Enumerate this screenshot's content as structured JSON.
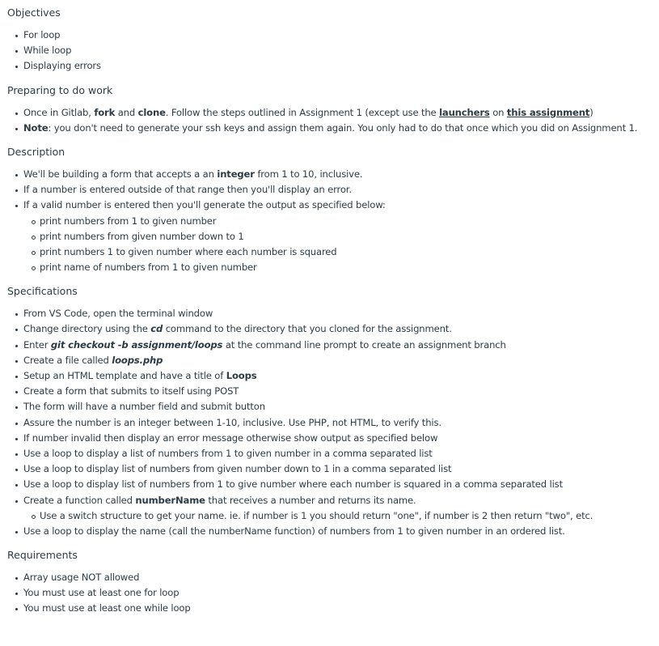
{
  "objectives": {
    "heading": "Objectives",
    "items": [
      "For loop",
      "While loop",
      "Displaying errors"
    ]
  },
  "preparing": {
    "heading": "Preparing to do work",
    "item1": {
      "t1": "Once in Gitlab, ",
      "b1": "fork",
      "t2": " and ",
      "b2": "clone",
      "t3": ". Follow the steps outlined in Assignment 1 (except use the ",
      "link1": "launchers",
      "t4": " on ",
      "link2": "this assignment",
      "t5": ")"
    },
    "item2": {
      "b1": "Note",
      "t1": ": you don't need to generate your ssh keys and assign them again. You only had to do that once which you did on Assignment 1."
    }
  },
  "description": {
    "heading": "Description",
    "item1": {
      "t1": "We'll be building a form that accepts a an ",
      "b1": "integer",
      "t2": " from 1 to 10, inclusive."
    },
    "item2": "If a number is entered outside of that range then you'll display an error.",
    "item3": "If a valid number is entered then you'll generate the output as specified below:",
    "sub_items": [
      "print numbers from 1 to given number",
      "print numbers from given number down to 1",
      "print numbers 1 to given number where each number is squared",
      "print name of numbers from 1 to given number"
    ]
  },
  "specifications": {
    "heading": "Specifications",
    "item1": "From VS Code, open the terminal window",
    "item2": {
      "t1": "Change directory using the ",
      "bi1": "cd",
      "t2": " command to the directory that you cloned for the assignment."
    },
    "item3": {
      "t1": "Enter ",
      "bi1": "git checkout -b assignment/loops",
      "t2": " at the command line prompt to create an assignment branch"
    },
    "item4": {
      "t1": "Create a file called ",
      "bi1": "loops.php"
    },
    "item5": {
      "t1": "Setup an HTML template and have a title of ",
      "b1": "Loops"
    },
    "item6": "Create a form that submits to itself using POST",
    "item7": "The form will have a number field and submit button",
    "item8": "Assure the number is an integer between 1-10, inclusive. Use PHP, not HTML, to verify this.",
    "item9": "If number invalid then display an error message otherwise show output as specified below",
    "item10": "Use a loop to display a list of numbers from 1 to given number in a comma separated list",
    "item11": "Use a loop to display list of numbers from given number down to 1 in a comma separated list",
    "item12": "Use a loop to display list of numbers from 1 to give number where each number is squared in a comma separated list",
    "item13": {
      "t1": "Create a function called ",
      "b1": "numberName",
      "t2": " that receives a number and returns its name."
    },
    "item13_sub": "Use a switch structure to get your name. ie. if number is 1 you should return \"one\", if number is 2 then return \"two\", etc.",
    "item14": "Use a loop to display the name (call the numberName function) of numbers from 1 to given number in an ordered list."
  },
  "requirements": {
    "heading": "Requirements",
    "items": [
      "Array usage NOT allowed",
      "You must use at least one for loop",
      "You must use at least one while loop"
    ]
  }
}
